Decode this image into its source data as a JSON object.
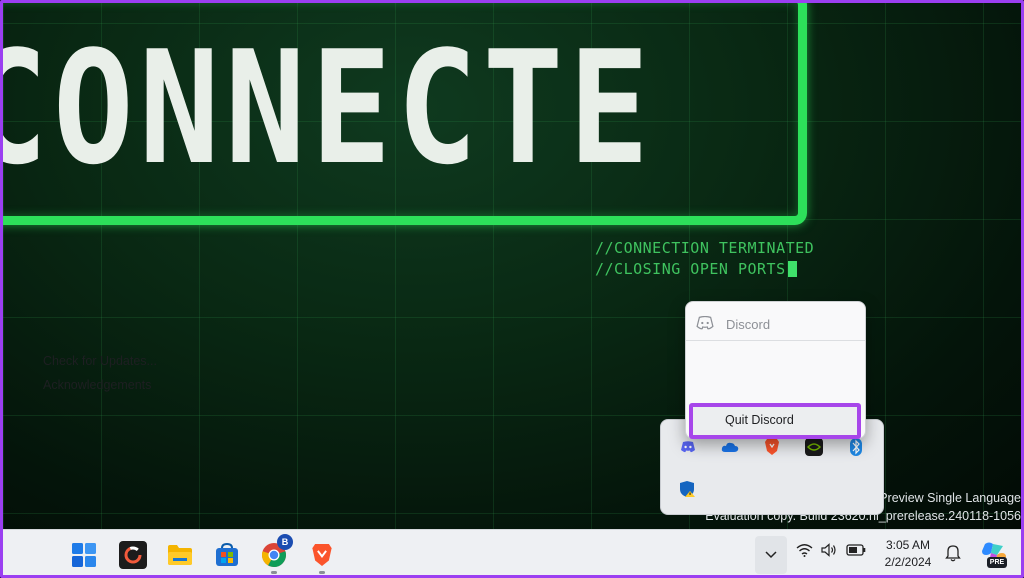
{
  "wallpaper": {
    "headline": "CONNECTED",
    "terminal_lines": [
      "//CONNECTION TERMINATED",
      "//CLOSING OPEN PORTS"
    ],
    "accent_color": "#2de05a"
  },
  "watermark": {
    "line1": "Preview Single Language",
    "line2": "Evaluation copy. Build 23620.ni_prerelease.240118-1056"
  },
  "context_menu": {
    "app_name": "Discord",
    "items": [
      "Check for Updates...",
      "Acknowledgements"
    ],
    "quit_label": "Quit Discord",
    "highlight_color": "#a746ea"
  },
  "tray_overflow": {
    "icons": [
      "discord-icon",
      "onedrive-icon",
      "brave-icon",
      "nvidia-icon",
      "bluetooth-icon",
      "windows-security-icon"
    ]
  },
  "taskbar": {
    "apps": [
      "start-icon",
      "app-icon",
      "file-explorer-icon",
      "microsoft-store-icon",
      "chrome-icon",
      "brave-icon"
    ],
    "chrome_badge": "B",
    "clock_time": "3:05 AM",
    "clock_date": "2/2/2024",
    "copilot_badge": "PRE"
  }
}
